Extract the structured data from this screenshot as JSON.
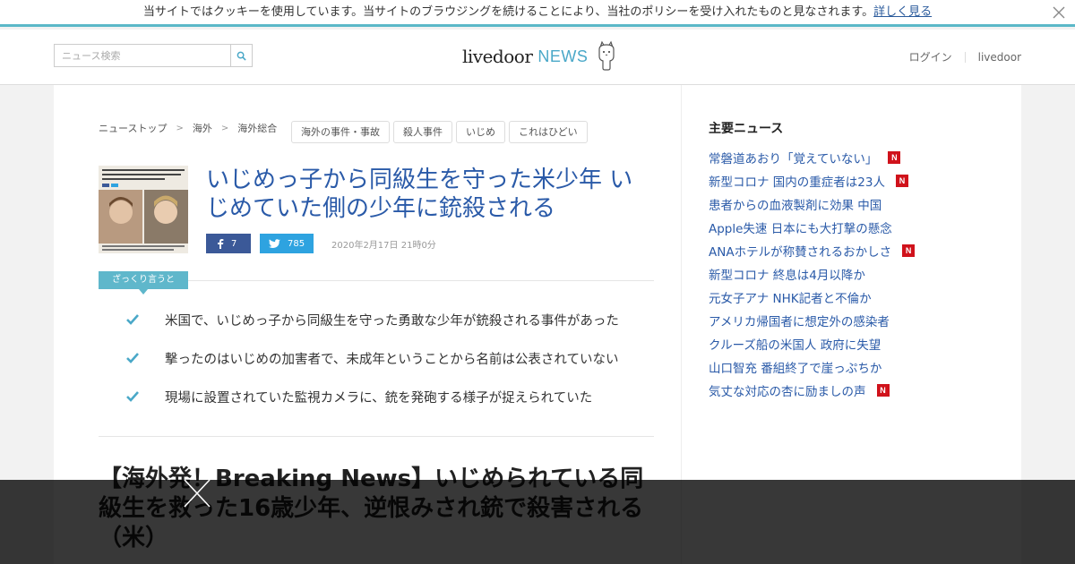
{
  "cookie": {
    "text": "当サイトではクッキーを使用しています。当サイトのブラウジングを続けることにより、当社のポリシーを受け入れたものと見なされます。",
    "link": "詳しく見る"
  },
  "header": {
    "search_placeholder": "ニュース検索",
    "logo_main": "livedoor",
    "logo_news": "NEWS",
    "login": "ログイン",
    "livedoor": "livedoor"
  },
  "breadcrumb": [
    "ニューストップ",
    "海外",
    "海外総合"
  ],
  "tags": [
    "海外の事件・事故",
    "殺人事件",
    "いじめ",
    "これはひどい"
  ],
  "article": {
    "title": "いじめっ子から同級生を守った米少年 いじめていた側の少年に銃殺される",
    "facebook_count": "7",
    "twitter_count": "785",
    "date": "2020年2月17日 21時0分",
    "summary_label": "ざっくり言うと",
    "summary": [
      "米国で、いじめっ子から同級生を守った勇敢な少年が銃殺される事件があった",
      "撃ったのはいじめの加害者で、未成年ということから名前は公表されていない",
      "現場に設置されていた監視カメラに、銃を発砲する様子が捉えられていた"
    ],
    "subhead": "【海外発！Breaking News】いじめられている同級生を救った16歳少年、逆恨みされ銃で殺害される（米）"
  },
  "sidebar": {
    "title": "主要ニュース",
    "items": [
      {
        "text": "常磐道あおり「覚えていない」",
        "new": true
      },
      {
        "text": "新型コロナ 国内の重症者は23人",
        "new": true
      },
      {
        "text": "患者からの血液製剤に効果 中国",
        "new": false
      },
      {
        "text": "Apple失速 日本にも大打撃の懸念",
        "new": false
      },
      {
        "text": "ANAホテルが称賛されるおかしさ",
        "new": true
      },
      {
        "text": "新型コロナ 終息は4月以降か",
        "new": false
      },
      {
        "text": "元女子アナ NHK記者と不倫か",
        "new": false
      },
      {
        "text": "アメリカ帰国者に想定外の感染者",
        "new": false
      },
      {
        "text": "クルーズ船の米国人 政府に失望",
        "new": false
      },
      {
        "text": "山口智充 番組終了で崖っぷちか",
        "new": false
      },
      {
        "text": "気丈な対応の杏に励ましの声",
        "new": true
      }
    ],
    "badge": "N"
  },
  "colors": {
    "accent": "#5fb7cb",
    "link": "#2a5aa8",
    "badge": "#d0121b"
  }
}
